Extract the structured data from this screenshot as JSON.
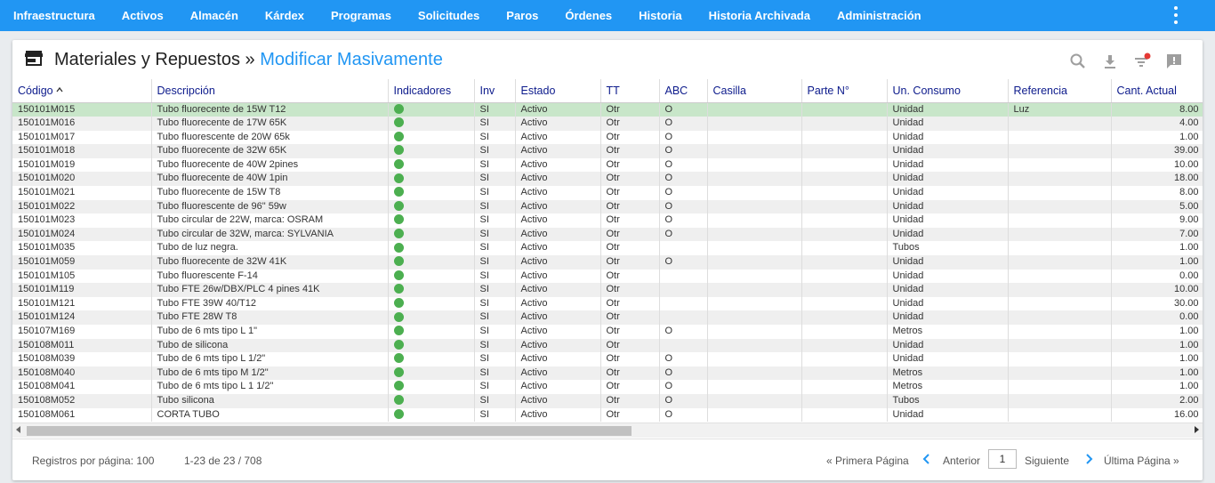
{
  "nav": {
    "items": [
      "Infraestructura",
      "Activos",
      "Almacén",
      "Kárdex",
      "Programas",
      "Solicitudes",
      "Paros",
      "Órdenes",
      "Historia",
      "Historia Archivada",
      "Administración"
    ]
  },
  "header": {
    "title": "Materiales y Repuestos",
    "separator": " » ",
    "subtitle": "Modificar Masivamente",
    "icons": [
      "search-icon",
      "download-icon",
      "filter-icon",
      "feedback-icon"
    ]
  },
  "table": {
    "columns": [
      "Código",
      "Descripción",
      "Indicadores",
      "Inv",
      "Estado",
      "TT",
      "ABC",
      "Casilla",
      "Parte N°",
      "Un. Consumo",
      "Referencia",
      "Cant. Actual"
    ],
    "rows": [
      [
        "150101M015",
        "Tubo fluorecente de 15W T12",
        "SI",
        "Activo",
        "Otr",
        "O",
        "",
        "",
        "Unidad",
        "Luz",
        "8.00"
      ],
      [
        "150101M016",
        "Tubo fluorecente de 17W 65K",
        "SI",
        "Activo",
        "Otr",
        "O",
        "",
        "",
        "Unidad",
        "",
        "4.00"
      ],
      [
        "150101M017",
        "Tubo fluorescente de 20W 65k",
        "SI",
        "Activo",
        "Otr",
        "O",
        "",
        "",
        "Unidad",
        "",
        "1.00"
      ],
      [
        "150101M018",
        "Tubo fluorecente de 32W 65K",
        "SI",
        "Activo",
        "Otr",
        "O",
        "",
        "",
        "Unidad",
        "",
        "39.00"
      ],
      [
        "150101M019",
        "Tubo fluorecente de 40W 2pines",
        "SI",
        "Activo",
        "Otr",
        "O",
        "",
        "",
        "Unidad",
        "",
        "10.00"
      ],
      [
        "150101M020",
        "Tubo fluorecente de 40W 1pin",
        "SI",
        "Activo",
        "Otr",
        "O",
        "",
        "",
        "Unidad",
        "",
        "18.00"
      ],
      [
        "150101M021",
        "Tubo fluorecente de 15W T8",
        "SI",
        "Activo",
        "Otr",
        "O",
        "",
        "",
        "Unidad",
        "",
        "8.00"
      ],
      [
        "150101M022",
        "Tubo fluorescente de 96\" 59w",
        "SI",
        "Activo",
        "Otr",
        "O",
        "",
        "",
        "Unidad",
        "",
        "5.00"
      ],
      [
        "150101M023",
        "Tubo circular de 22W, marca: OSRAM",
        "SI",
        "Activo",
        "Otr",
        "O",
        "",
        "",
        "Unidad",
        "",
        "9.00"
      ],
      [
        "150101M024",
        "Tubo circular de 32W, marca: SYLVANIA",
        "SI",
        "Activo",
        "Otr",
        "O",
        "",
        "",
        "Unidad",
        "",
        "7.00"
      ],
      [
        "150101M035",
        "Tubo de luz negra.",
        "SI",
        "Activo",
        "Otr",
        "",
        "",
        "",
        "Tubos",
        "",
        "1.00"
      ],
      [
        "150101M059",
        "Tubo fluorecente de 32W 41K",
        "SI",
        "Activo",
        "Otr",
        "O",
        "",
        "",
        "Unidad",
        "",
        "1.00"
      ],
      [
        "150101M105",
        "Tubo fluorescente F-14",
        "SI",
        "Activo",
        "Otr",
        "",
        "",
        "",
        "Unidad",
        "",
        "0.00"
      ],
      [
        "150101M119",
        "Tubo FTE 26w/DBX/PLC 4 pines 41K",
        "SI",
        "Activo",
        "Otr",
        "",
        "",
        "",
        "Unidad",
        "",
        "10.00"
      ],
      [
        "150101M121",
        "Tubo FTE 39W 40/T12",
        "SI",
        "Activo",
        "Otr",
        "",
        "",
        "",
        "Unidad",
        "",
        "30.00"
      ],
      [
        "150101M124",
        "Tubo FTE 28W T8",
        "SI",
        "Activo",
        "Otr",
        "",
        "",
        "",
        "Unidad",
        "",
        "0.00"
      ],
      [
        "150107M169",
        "Tubo de 6 mts tipo L 1\"",
        "SI",
        "Activo",
        "Otr",
        "O",
        "",
        "",
        "Metros",
        "",
        "1.00"
      ],
      [
        "150108M011",
        "Tubo de silicona",
        "SI",
        "Activo",
        "Otr",
        "",
        "",
        "",
        "Unidad",
        "",
        "1.00"
      ],
      [
        "150108M039",
        "Tubo de 6 mts tipo L 1/2\"",
        "SI",
        "Activo",
        "Otr",
        "O",
        "",
        "",
        "Unidad",
        "",
        "1.00"
      ],
      [
        "150108M040",
        "Tubo de 6 mts tipo M 1/2\"",
        "SI",
        "Activo",
        "Otr",
        "O",
        "",
        "",
        "Metros",
        "",
        "1.00"
      ],
      [
        "150108M041",
        "Tubo de 6 mts tipo L 1 1/2\"",
        "SI",
        "Activo",
        "Otr",
        "O",
        "",
        "",
        "Metros",
        "",
        "1.00"
      ],
      [
        "150108M052",
        "Tubo silicona",
        "SI",
        "Activo",
        "Otr",
        "O",
        "",
        "",
        "Tubos",
        "",
        "2.00"
      ],
      [
        "150108M061",
        "CORTA TUBO",
        "SI",
        "Activo",
        "Otr",
        "O",
        "",
        "",
        "Unidad",
        "",
        "16.00"
      ]
    ]
  },
  "footer": {
    "per_page_label": "Registros por página: 100",
    "range": "1-23 de 23 / 708",
    "first": "« Primera Página",
    "prev": "Anterior",
    "page": "1",
    "next": "Siguiente",
    "last": "Última Página »"
  },
  "colors": {
    "nav": "#2196f3",
    "accent": "#2196f3",
    "selected_row": "#c8e6c9",
    "indicator": "#4caf50",
    "header_text": "#0d1b8c"
  }
}
